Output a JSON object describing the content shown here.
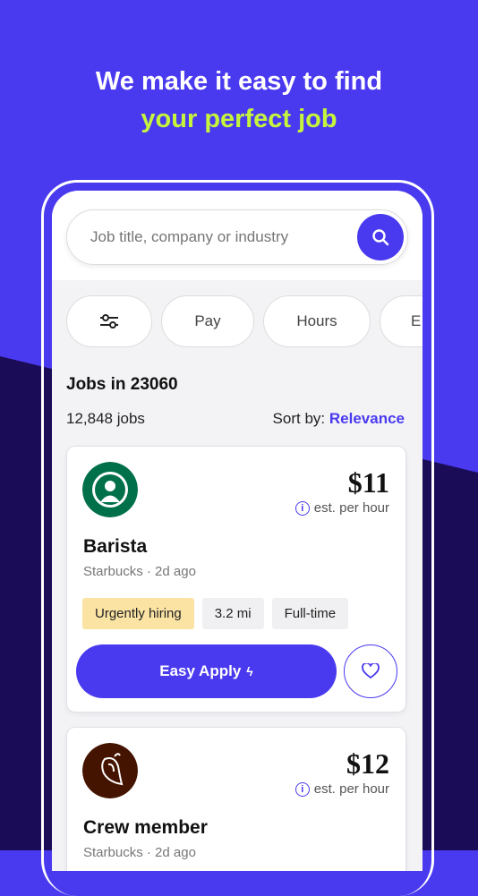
{
  "headline": {
    "line1": "We make it easy to find",
    "line2": "your perfect job"
  },
  "search": {
    "placeholder": "Job title, company or industry"
  },
  "filters": [
    {
      "label": ""
    },
    {
      "label": "Pay"
    },
    {
      "label": "Hours"
    },
    {
      "label": "E"
    }
  ],
  "results": {
    "title": "Jobs in 23060",
    "count": "12,848 jobs",
    "sort_label": "Sort by:",
    "sort_value": "Relevance"
  },
  "jobs": [
    {
      "price": "$11",
      "est": "est. per hour",
      "title": "Barista",
      "company": "Starbucks",
      "age": "2d ago",
      "tags": [
        "Urgently hiring",
        "3.2 mi",
        "Full-time"
      ],
      "apply": "Easy Apply",
      "logo_color": "#00704a"
    },
    {
      "price": "$12",
      "est": "est. per hour",
      "title": "Crew member",
      "company": "Starbucks",
      "age": "2d ago",
      "logo_color": "#451400"
    }
  ],
  "colors": {
    "brand": "#4a3aef",
    "accent": "#c4f53c",
    "dark": "#1b0c58"
  }
}
